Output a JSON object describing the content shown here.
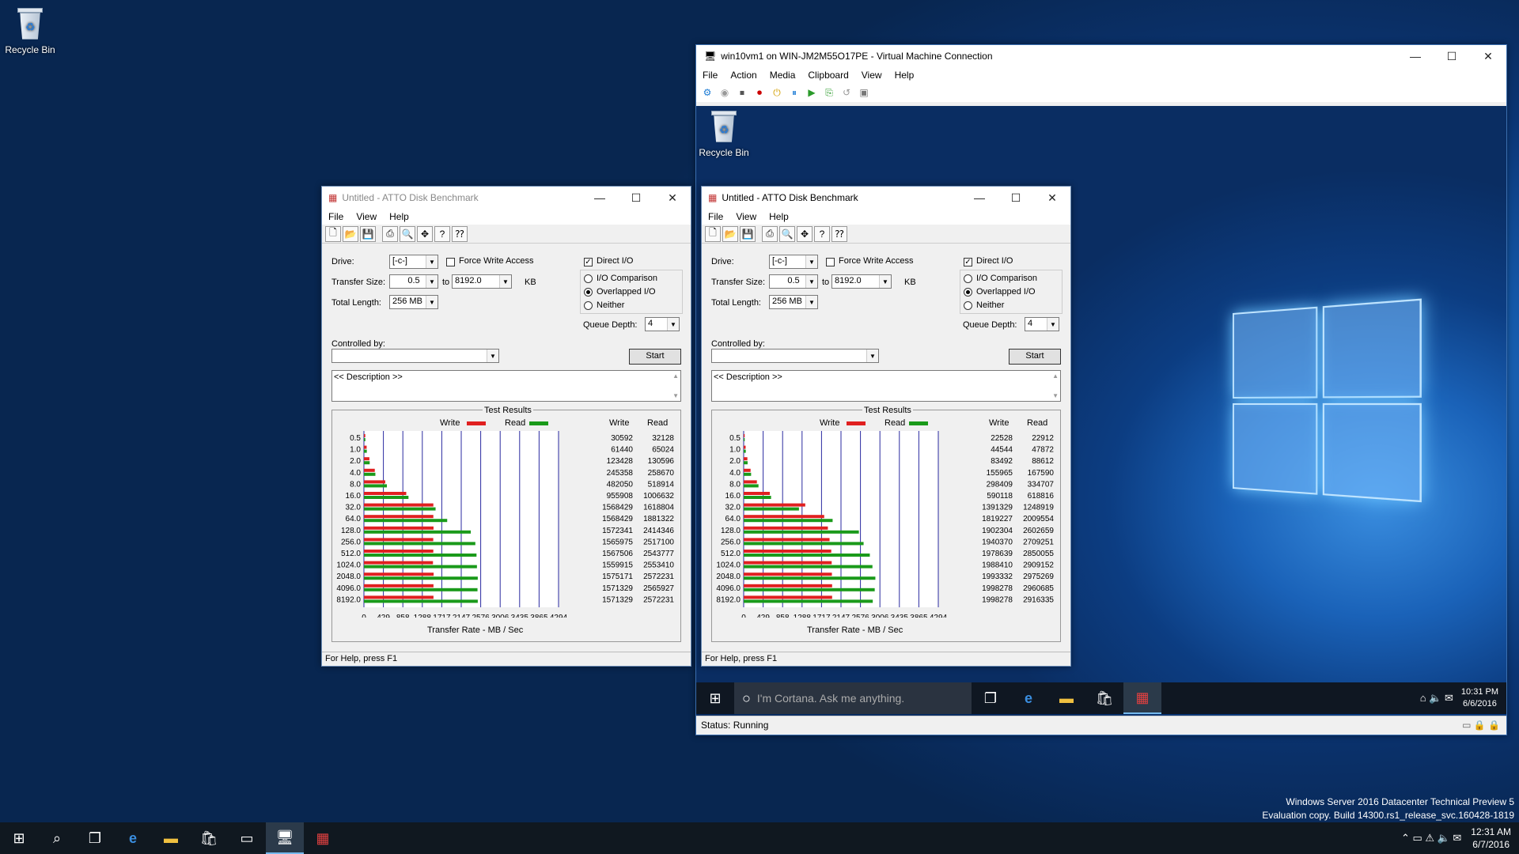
{
  "desktop": {
    "recycle_bin": "Recycle Bin",
    "watermark_line1": "Windows Server 2016 Datacenter Technical Preview 5",
    "watermark_line2": "Evaluation copy. Build 14300.rs1_release_svc.160428-1819"
  },
  "host_clock": {
    "time": "12:31 AM",
    "date": "6/7/2016"
  },
  "vm_window": {
    "title": "win10vm1 on WIN-JM2M55O17PE - Virtual Machine Connection",
    "menu": [
      "File",
      "Action",
      "Media",
      "Clipboard",
      "View",
      "Help"
    ],
    "status": "Status: Running",
    "recycle_bin": "Recycle Bin",
    "cortana": "I'm Cortana. Ask me anything.",
    "clock_time": "10:31 PM",
    "clock_date": "6/6/2016"
  },
  "atto_common": {
    "menu": [
      "File",
      "View",
      "Help"
    ],
    "drive_label": "Drive:",
    "drive": "[-c-]",
    "force_write": "Force Write Access",
    "direct_io": "Direct I/O",
    "transfer_label": "Transfer Size:",
    "from": "0.5",
    "to_label": "to",
    "to": "8192.0",
    "kb": "KB",
    "total_label": "Total Length:",
    "total": "256 MB",
    "io_comp": "I/O Comparison",
    "overlapped": "Overlapped I/O",
    "neither": "Neither",
    "queue_label": "Queue Depth:",
    "queue": "4",
    "controlled": "Controlled by:",
    "start": "Start",
    "description": "<< Description >>",
    "results_title": "Test Results",
    "write_legend": "Write",
    "read_legend": "Read",
    "col_write": "Write",
    "col_read": "Read",
    "xlabel": "Transfer Rate - MB / Sec",
    "help": "For Help, press F1"
  },
  "atto_left": {
    "title": "Untitled - ATTO Disk Benchmark"
  },
  "atto_right": {
    "title": "Untitled - ATTO Disk Benchmark"
  },
  "chart_data": [
    {
      "type": "bar",
      "title": "Test Results",
      "xlabel": "Transfer Rate - MB / Sec",
      "xlim": [
        0,
        4294
      ],
      "x_ticks": [
        "0",
        "429",
        "858",
        "1288",
        "1717",
        "2147",
        "2576",
        "3006",
        "3435",
        "3865",
        "4294"
      ],
      "categories": [
        "0.5",
        "1.0",
        "2.0",
        "4.0",
        "8.0",
        "16.0",
        "32.0",
        "64.0",
        "128.0",
        "256.0",
        "512.0",
        "1024.0",
        "2048.0",
        "4096.0",
        "8192.0"
      ],
      "series": [
        {
          "name": "Write",
          "color": "#e02020",
          "values": [
            30592,
            61440,
            123428,
            245358,
            482050,
            955908,
            1568429,
            1568429,
            1572341,
            1565975,
            1567506,
            1559915,
            1575171,
            1571329,
            1571329
          ]
        },
        {
          "name": "Read",
          "color": "#1a9a1a",
          "values": [
            32128,
            65024,
            130596,
            258670,
            518914,
            1006632,
            1618804,
            1881322,
            2414346,
            2517100,
            2543777,
            2553410,
            2572231,
            2565927,
            2572231
          ]
        }
      ]
    },
    {
      "type": "bar",
      "title": "Test Results",
      "xlabel": "Transfer Rate - MB / Sec",
      "xlim": [
        0,
        4294
      ],
      "x_ticks": [
        "0",
        "429",
        "858",
        "1288",
        "1717",
        "2147",
        "2576",
        "3006",
        "3435",
        "3865",
        "4294"
      ],
      "categories": [
        "0.5",
        "1.0",
        "2.0",
        "4.0",
        "8.0",
        "16.0",
        "32.0",
        "64.0",
        "128.0",
        "256.0",
        "512.0",
        "1024.0",
        "2048.0",
        "4096.0",
        "8192.0"
      ],
      "series": [
        {
          "name": "Write",
          "color": "#e02020",
          "values": [
            22528,
            44544,
            83492,
            155965,
            298409,
            590118,
            1391329,
            1819227,
            1902304,
            1940370,
            1978639,
            1988410,
            1993332,
            1998278,
            1998278
          ]
        },
        {
          "name": "Read",
          "color": "#1a9a1a",
          "values": [
            22912,
            47872,
            88612,
            167590,
            334707,
            618816,
            1248919,
            2009554,
            2602659,
            2709251,
            2850055,
            2909152,
            2975269,
            2960685,
            2916335
          ]
        }
      ]
    }
  ]
}
